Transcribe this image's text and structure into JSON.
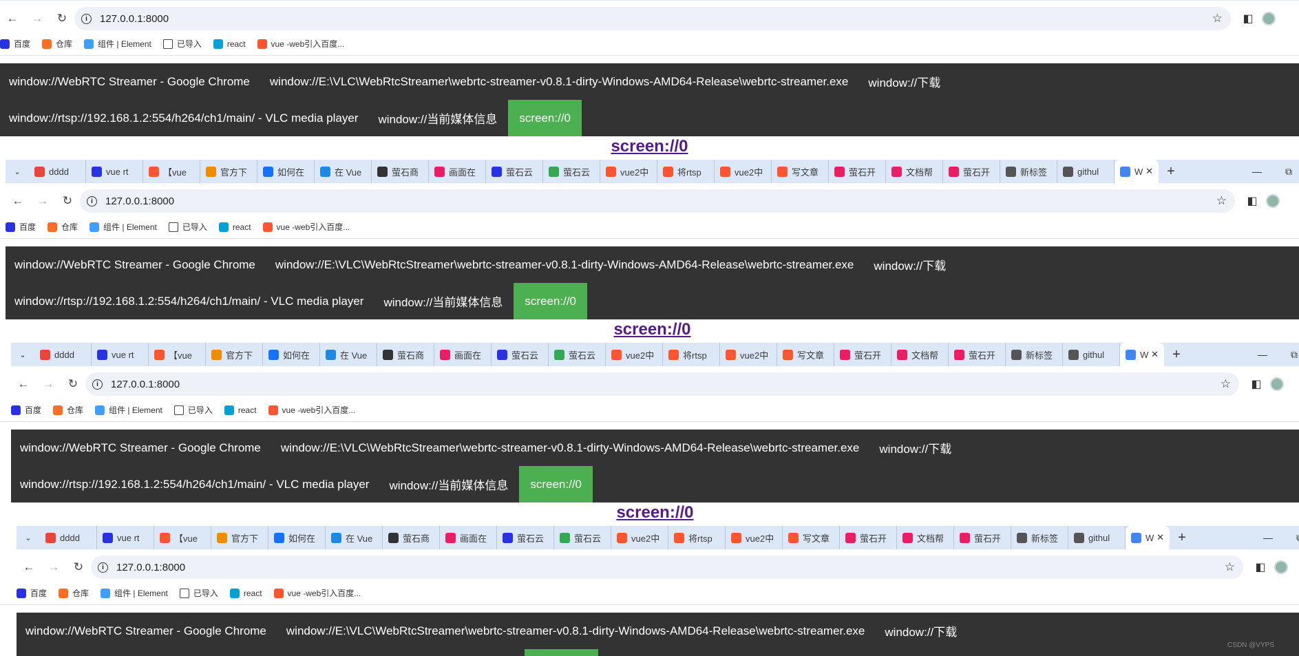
{
  "browser": {
    "url": "127.0.0.1:8000",
    "tabs": [
      {
        "label": "dddd",
        "icon": "wechat-icon",
        "color": "#e8453c"
      },
      {
        "label": "vue rt",
        "icon": "baidu-icon",
        "color": "#2932e1"
      },
      {
        "label": "【vue",
        "icon": "csdn-icon",
        "color": "#fc5531"
      },
      {
        "label": "官方下",
        "icon": "vlc-icon",
        "color": "#f08c00"
      },
      {
        "label": "如何在",
        "icon": "zhihu-icon",
        "color": "#1772f6"
      },
      {
        "label": "在 Vue",
        "icon": "861-icon",
        "color": "#1e88e5"
      },
      {
        "label": "萤石商",
        "icon": "github-icon",
        "color": "#333333"
      },
      {
        "label": "画面在",
        "icon": "pinwheel-icon",
        "color": "#e91e63"
      },
      {
        "label": "萤石云",
        "icon": "baidu-icon",
        "color": "#2932e1"
      },
      {
        "label": "萤石云",
        "icon": "map-pin-icon",
        "color": "#34a853"
      },
      {
        "label": "vue2中",
        "icon": "csdn-icon",
        "color": "#fc5531"
      },
      {
        "label": "将rtsp",
        "icon": "csdn-icon",
        "color": "#fc5531"
      },
      {
        "label": "vue2中",
        "icon": "csdn-icon",
        "color": "#fc5531"
      },
      {
        "label": "写文章",
        "icon": "csdn-icon",
        "color": "#fc5531"
      },
      {
        "label": "萤石开",
        "icon": "pinwheel-icon",
        "color": "#e91e63"
      },
      {
        "label": "文档帮",
        "icon": "pinwheel-icon",
        "color": "#e91e63"
      },
      {
        "label": "萤石开",
        "icon": "pinwheel-icon",
        "color": "#e91e63"
      },
      {
        "label": "新标签",
        "icon": "globe-icon",
        "color": "#555555"
      },
      {
        "label": "githul",
        "icon": "globe-icon",
        "color": "#555555"
      },
      {
        "label": "W",
        "icon": "chrome-icon",
        "color": "#4285f4",
        "active": true
      }
    ],
    "bookmarks": [
      {
        "label": "百度",
        "icon": "baidu-icon",
        "color": "#2932e1"
      },
      {
        "label": "仓库",
        "icon": "gitlab-icon",
        "color": "#fc6d26"
      },
      {
        "label": "组件 | Element",
        "icon": "element-icon",
        "color": "#409eff"
      },
      {
        "label": "已导入",
        "icon": "folder-icon",
        "color": "#ffffff"
      },
      {
        "label": "react",
        "icon": "bilibili-icon",
        "color": "#00a1d6"
      },
      {
        "label": "vue -web引入百度...",
        "icon": "csdn-icon",
        "color": "#fc5531"
      }
    ]
  },
  "sources": {
    "row1": [
      "window://WebRTC Streamer - Google Chrome",
      "window://E:\\VLC\\WebRtcStreamer\\webrtc-streamer-v0.8.1-dirty-Windows-AMD64-Release\\webrtc-streamer.exe",
      "window://下载"
    ],
    "row2": [
      "window://rtsp://192.168.1.2:554/h264/ch1/main/ - VLC media player",
      "window://当前媒体信息",
      "screen://0"
    ],
    "selected": "screen://0"
  },
  "heading": "screen://0",
  "watermark": "CSDN @VYPS",
  "colors": {
    "source_bg": "#333333",
    "selected_bg": "#4caf50",
    "tabstrip_bg": "#dce7f7",
    "omnibox_bg": "#eef2f8",
    "heading_color": "#551a8b"
  }
}
